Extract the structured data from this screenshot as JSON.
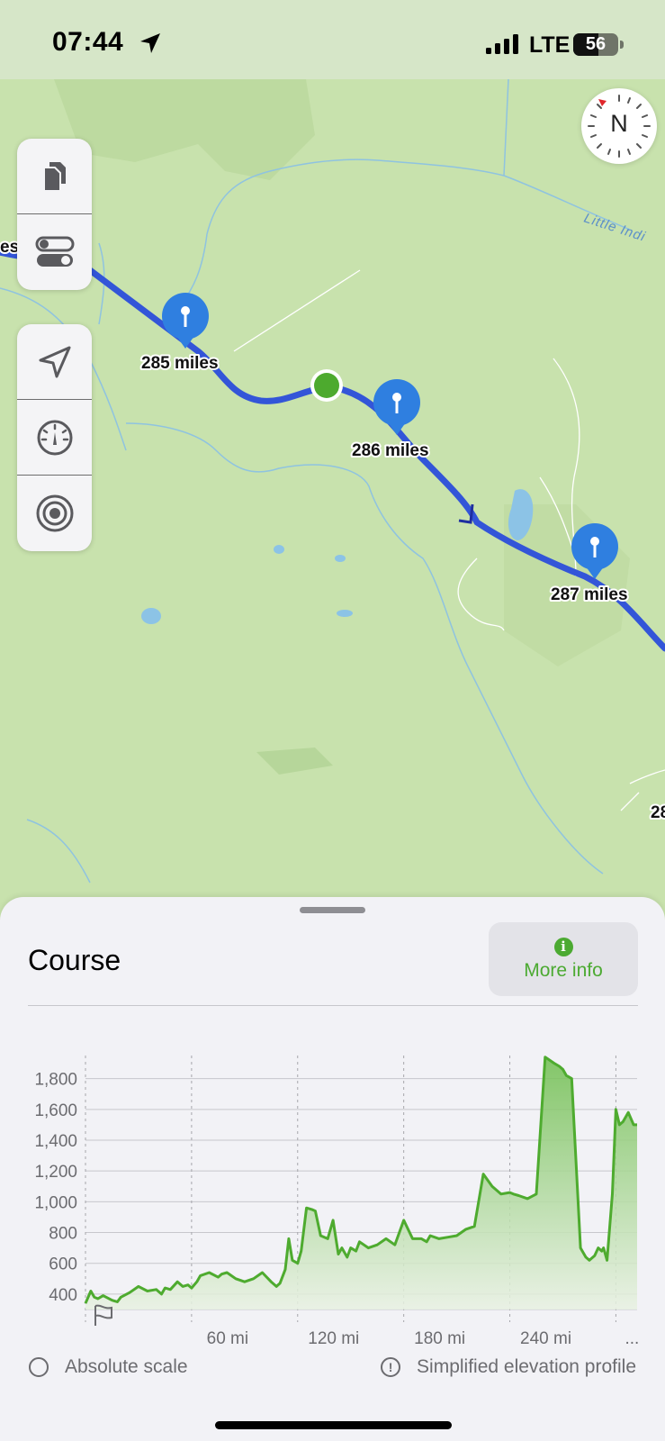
{
  "status_bar": {
    "time": "07:44",
    "network": "LTE",
    "battery": "56",
    "battery_level": 0.56
  },
  "map": {
    "compass_label": "N",
    "river_label": "Little Indi",
    "edge_label_left": "es",
    "edge_label_right": "28",
    "mile_markers": [
      {
        "label": "285 miles"
      },
      {
        "label": "286 miles"
      },
      {
        "label": "287 miles"
      }
    ],
    "colors": {
      "route": "#3355d8",
      "land": "#c8e2ad",
      "water": "#8cc3e6",
      "position": "#4daa2e",
      "pin": "#2f7fe0"
    }
  },
  "toolbar": {
    "group1": [
      {
        "icon": "documents-icon"
      },
      {
        "icon": "toggles-icon"
      }
    ],
    "group2": [
      {
        "icon": "navigation-arrow-icon"
      },
      {
        "icon": "gauge-icon"
      },
      {
        "icon": "target-icon"
      }
    ]
  },
  "sheet": {
    "title": "Course",
    "more_info_icon": "i",
    "more_info_label": "More info",
    "absolute_scale_label": "Absolute scale",
    "warning_icon": "!",
    "simplified_label": "Simplified elevation profile"
  },
  "chart_data": {
    "type": "area",
    "title": "",
    "xlabel": "",
    "ylabel": "",
    "xlim": [
      0,
      312
    ],
    "ylim": [
      300,
      1950
    ],
    "yticks": [
      "1,800",
      "1,600",
      "1,400",
      "1,200",
      "1,000",
      "800",
      "600",
      "400"
    ],
    "xticks": [
      "60 mi",
      "120 mi",
      "180 mi",
      "240 mi",
      "..."
    ],
    "start_icon": "flag-icon",
    "x": [
      0,
      3,
      5,
      7,
      10,
      15,
      18,
      20,
      25,
      30,
      35,
      40,
      43,
      45,
      48,
      52,
      55,
      58,
      60,
      63,
      65,
      70,
      75,
      77,
      80,
      85,
      90,
      95,
      100,
      105,
      108,
      110,
      113,
      115,
      117,
      120,
      122,
      125,
      128,
      130,
      133,
      137,
      140,
      143,
      145,
      148,
      150,
      153,
      155,
      160,
      165,
      170,
      175,
      180,
      185,
      190,
      193,
      195,
      200,
      205,
      210,
      215,
      220,
      225,
      230,
      235,
      240,
      242,
      245,
      250,
      255,
      260,
      265,
      268,
      270,
      272,
      275,
      280,
      283,
      285,
      288,
      290,
      292,
      293,
      295,
      298,
      300,
      302,
      304,
      306,
      307,
      310,
      312
    ],
    "values": [
      340,
      420,
      380,
      370,
      390,
      360,
      350,
      380,
      410,
      450,
      420,
      430,
      400,
      440,
      430,
      480,
      450,
      460,
      440,
      480,
      520,
      540,
      510,
      530,
      540,
      500,
      480,
      500,
      540,
      480,
      450,
      470,
      560,
      760,
      620,
      600,
      680,
      960,
      950,
      940,
      780,
      760,
      880,
      660,
      700,
      640,
      700,
      680,
      740,
      700,
      720,
      760,
      720,
      880,
      760,
      760,
      740,
      780,
      760,
      770,
      780,
      820,
      840,
      1180,
      1100,
      1050,
      1060,
      1050,
      1040,
      1020,
      1050,
      1940,
      1900,
      1880,
      1860,
      1820,
      1800,
      700,
      640,
      620,
      650,
      700,
      680,
      700,
      620,
      1050,
      1600,
      1500,
      1520,
      1560,
      1580,
      1500,
      1500
    ],
    "colors": {
      "line": "#4eab2f",
      "fill_top": "#6fbe4f",
      "fill_bottom": "#e8f1e2",
      "grid": "#c7c7cc"
    }
  }
}
